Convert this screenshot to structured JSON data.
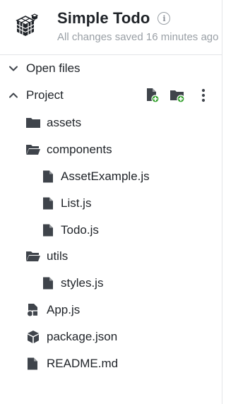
{
  "header": {
    "title": "Simple Todo",
    "subtitle": "All changes saved 16 minutes ago",
    "logo_icon": "cube-logo-icon",
    "info_icon": "info-icon"
  },
  "tree": {
    "sections": {
      "open_files": {
        "label": "Open files",
        "expanded": false
      },
      "project": {
        "label": "Project",
        "expanded": true
      }
    },
    "actions": {
      "new_file": "new-file-icon",
      "new_folder": "new-folder-icon",
      "more": "more-vertical-icon"
    },
    "items": [
      {
        "label": "assets",
        "type": "folder",
        "open": false
      },
      {
        "label": "components",
        "type": "folder",
        "open": true
      },
      {
        "label": "AssetExample.js",
        "type": "file"
      },
      {
        "label": "List.js",
        "type": "file"
      },
      {
        "label": "Todo.js",
        "type": "file"
      },
      {
        "label": "utils",
        "type": "folder",
        "open": true
      },
      {
        "label": "styles.js",
        "type": "file"
      },
      {
        "label": "App.js",
        "type": "app-file"
      },
      {
        "label": "package.json",
        "type": "package"
      },
      {
        "label": "README.md",
        "type": "file"
      }
    ]
  },
  "colors": {
    "icon": "#3f444b",
    "add_badge": "#3aa334",
    "muted": "#9aa0a6",
    "divider": "#e3e5e8"
  }
}
